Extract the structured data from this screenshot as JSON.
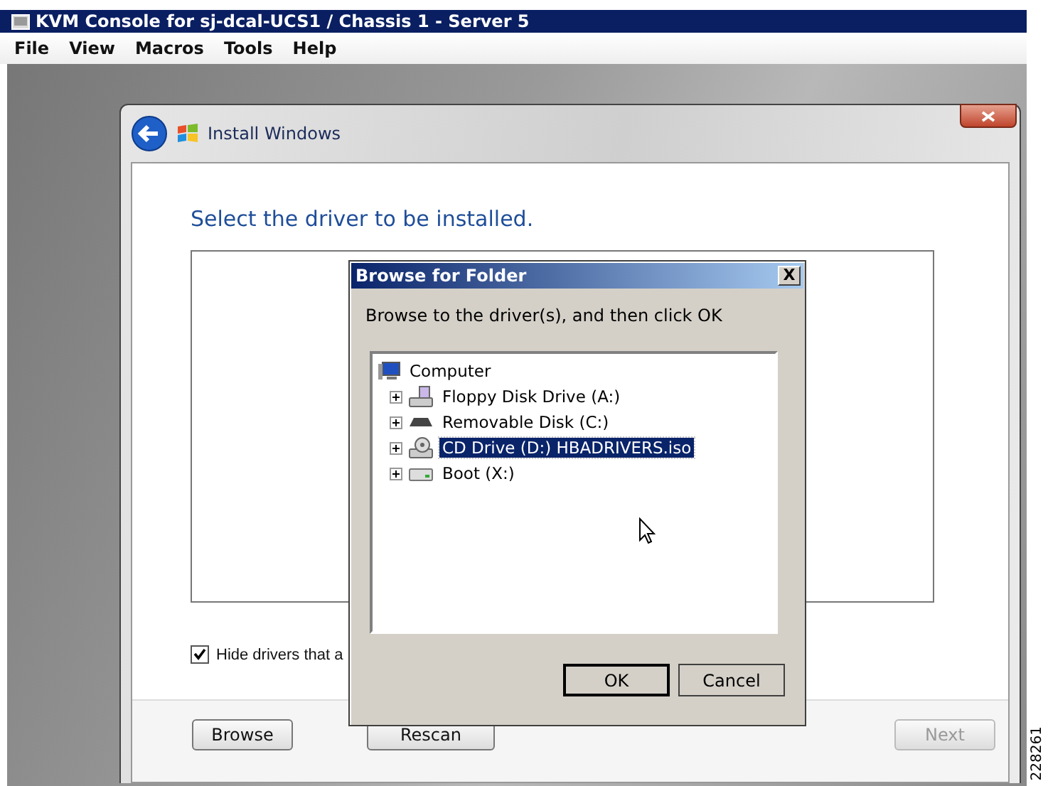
{
  "window": {
    "title": "KVM Console for sj-dcal-UCS1 / Chassis 1 - Server 5"
  },
  "menu": [
    "File",
    "View",
    "Macros",
    "Tools",
    "Help"
  ],
  "installer": {
    "title": "Install Windows",
    "heading": "Select the driver to be installed.",
    "hide_checkbox": {
      "label": "Hide drivers that a",
      "checked": true
    },
    "buttons": [
      {
        "label": "Browse",
        "disabled": false
      },
      {
        "label": "Rescan",
        "disabled": false
      },
      {
        "label": "Next",
        "disabled": true
      }
    ]
  },
  "dialog": {
    "title": "Browse for Folder",
    "close": "X",
    "prompt": "Browse to the driver(s), and then click OK",
    "tree": [
      {
        "label": "Computer",
        "kind": "computer",
        "selected": false,
        "children": [
          {
            "label": "Floppy Disk Drive (A:)",
            "kind": "floppy",
            "expanded": false,
            "selected": false
          },
          {
            "label": "Removable Disk (C:)",
            "kind": "removable",
            "expanded": false,
            "selected": false
          },
          {
            "label": "CD Drive (D:) HBADRIVERS.iso",
            "kind": "cd",
            "expanded": false,
            "selected": true
          },
          {
            "label": "Boot (X:)",
            "kind": "disk",
            "expanded": false,
            "selected": false
          }
        ]
      }
    ],
    "buttons": [
      {
        "label": "OK",
        "default": true
      },
      {
        "label": "Cancel",
        "default": false
      }
    ]
  },
  "figure_number": "228261"
}
